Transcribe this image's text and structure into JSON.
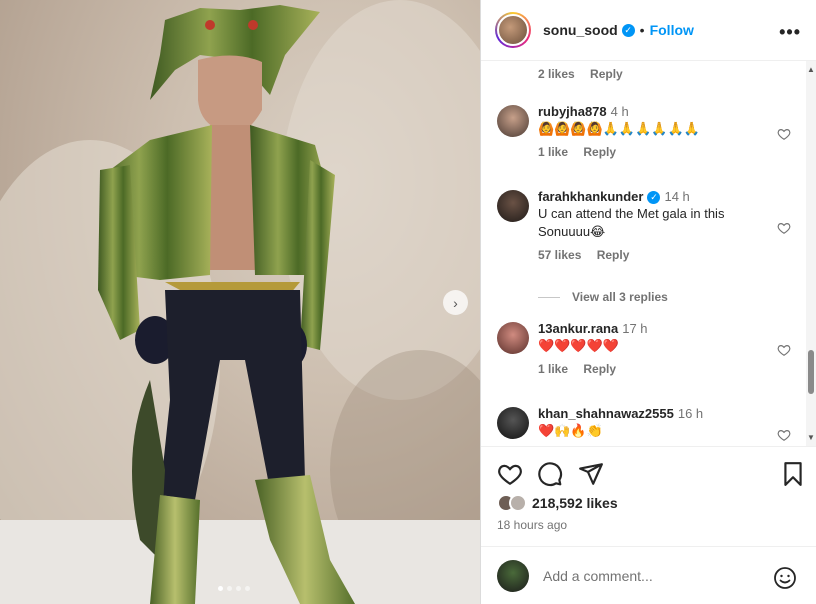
{
  "header": {
    "username": "sonu_sood",
    "separator": "•",
    "follow_label": "Follow",
    "more_label": "•••"
  },
  "top_meta": {
    "likes": "2 likes",
    "reply": "Reply"
  },
  "comments": [
    {
      "username": "rubyjha878",
      "time": "4 h",
      "text": "🙆🙆🙆🙆🙏🙏🙏🙏🙏🙏",
      "likes": "1 like",
      "reply": "Reply"
    },
    {
      "username": "farahkhankunder",
      "time": "14 h",
      "text": "U can attend the Met gala in this Sonuuuu😂",
      "likes": "57 likes",
      "reply": "Reply"
    },
    {
      "username": "13ankur.rana",
      "time": "17 h",
      "text": "❤️❤️❤️❤️❤️",
      "likes": "1 like",
      "reply": "Reply"
    },
    {
      "username": "khan_shahnawaz2555",
      "time": "16 h",
      "text": "❤️🙌🔥👏"
    }
  ],
  "view_replies": "View all 3 replies",
  "post": {
    "likes_count": "218,592 likes",
    "time_ago": "18 hours ago"
  },
  "add_comment": {
    "placeholder": "Add a comment..."
  },
  "carousel": {
    "next_label": "›",
    "slide_count": 4,
    "active_slide": 0
  },
  "colors": {
    "accent": "#0095f6",
    "muted": "#737373",
    "text": "#262626"
  },
  "icons": [
    "verified-icon",
    "more-icon",
    "heart-icon",
    "comment-icon",
    "share-icon",
    "save-icon",
    "emoji-icon",
    "chevron-right-icon"
  ]
}
